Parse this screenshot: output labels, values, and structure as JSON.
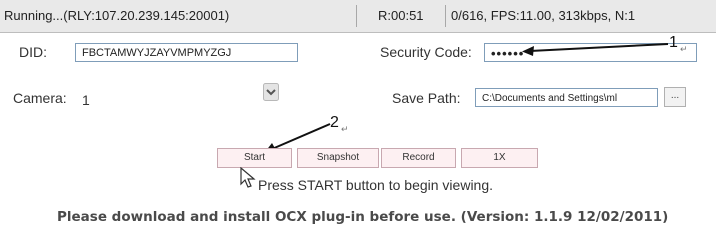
{
  "status": {
    "connection": "Running...(RLY:107.20.239.145:20001)",
    "timer": "R:00:51",
    "stats": "0/616, FPS:11.00, 313kbps, N:1"
  },
  "form": {
    "did_label": "DID:",
    "did_value": "FBCTAMWYJZAYVMPMYZGJ",
    "security_label": "Security Code:",
    "security_value": "••••••",
    "camera_label": "Camera:",
    "camera_value": "1",
    "save_path_label": "Save Path:",
    "save_path_value": "C:\\Documents and Settings\\ml",
    "browse_label": "..."
  },
  "buttons": {
    "start": "Start",
    "snapshot": "Snapshot",
    "record": "Record",
    "speed": "1X"
  },
  "hint": "Press START button to begin viewing.",
  "footer": "Please download and install OCX plug-in before use. (Version: 1.1.9 12/02/2011)",
  "annotations": {
    "one": "1",
    "two": "2",
    "return_mark": "↵"
  },
  "icons": [
    "dropdown-arrow-icon",
    "mouse-cursor-icon",
    "annotation-arrow-icon"
  ],
  "colors": {
    "statusbar_bg": "#e9e9e9",
    "button_bg": "#fdf0f2",
    "button_border": "#c8a8b0"
  }
}
